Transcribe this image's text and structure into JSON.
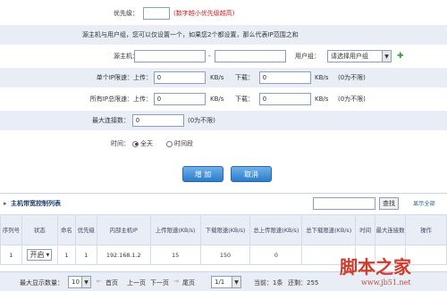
{
  "form": {
    "priority_label": "优先级：",
    "priority_value": "",
    "priority_hint": "(数字越小优先级越高)",
    "src_hint": "源主机与用户组，您可以仅设置一个，如果您2个都设置，那么代表IP范围之和",
    "src_host_label": "源主机：",
    "src_host_from": "",
    "range_sep": "-",
    "src_host_to": "",
    "user_group_label": "用户组：",
    "user_group_value": "请选择用户组",
    "single_ip_label": "单个IP限速：上传：",
    "single_up": "0",
    "unit_kbs": "KB/s",
    "download_label": "下载：",
    "single_down": "0",
    "unlimited_hint": "(0为不限)",
    "all_ip_label": "所有IP总限速：上传：",
    "all_up": "0",
    "all_down": "0",
    "max_conn_label": "最大连接数：",
    "max_conn_value": "0",
    "time_label": "时间：",
    "time_all_day": "全天",
    "time_period": "时间段",
    "add_button": "增 加",
    "cancel_button": "取消"
  },
  "list": {
    "title": "主机带宽控制列表",
    "search_value": "",
    "search_button": "查找",
    "show_all": "显示全部",
    "columns": [
      "序列号",
      "状态",
      "命名",
      "优先级",
      "内部主机IP",
      "上传限速(KB/s)",
      "下载限速(KB/s)",
      "总上传限速(KB/s)",
      "总下载限速(KB/s)",
      "时间",
      "最大连接数",
      "操作"
    ],
    "rows": [
      {
        "seq": "1",
        "status": "开启",
        "name": "1",
        "priority": "1",
        "ip": "192.168.1.2",
        "up": "15",
        "down": "150",
        "total_up": "0",
        "total_down": "",
        "time": "",
        "max": "",
        "op": ""
      }
    ]
  },
  "pager": {
    "per_page_label": "最大显示数量：",
    "per_page_value": "10",
    "first": "首页",
    "prev": "上一页",
    "next": "下一页",
    "last": "尾页",
    "page_value": "1/1",
    "current": "当前：1条",
    "total": "还剩：255"
  },
  "watermark": {
    "main": "脚本之家",
    "url": "www.jb51.net"
  }
}
